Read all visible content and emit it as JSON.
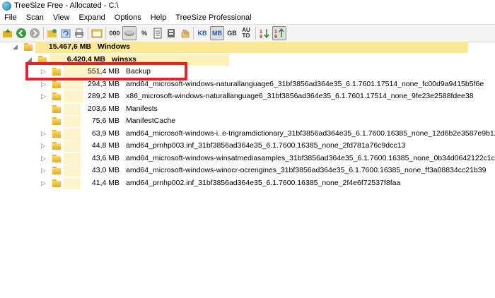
{
  "window": {
    "title": "TreeSize Free - Allocated - C:\\"
  },
  "menu": [
    "File",
    "Scan",
    "View",
    "Expand",
    "Options",
    "Help",
    "TreeSize Professional"
  ],
  "toolbar": {
    "text_buttons": {
      "digits": "000",
      "percent": "%",
      "kb": "KB",
      "mb": "MB",
      "gb": "GB",
      "auto": "AU TO"
    }
  },
  "tree": {
    "rows": [
      {
        "size": "15.467,6 MB",
        "name": "Windows",
        "arrow": "◢",
        "bar_fraction": 1.0
      },
      {
        "size": "6.420,4 MB",
        "name": "winsxs",
        "arrow": "◢",
        "bar_fraction": 0.415
      },
      {
        "size": "551,4 MB",
        "name": "Backup",
        "arrow": "▷",
        "bar_fraction": 0.086
      },
      {
        "size": "294,3 MB",
        "name": "amd64_microsoft-windows-naturallanguage6_31bf3856ad364e35_6.1.7601.17514_none_fc00d9a9415b5f6e",
        "arrow": "▷",
        "bar_fraction": 0.046
      },
      {
        "size": "289,2 MB",
        "name": "x86_microsoft-windows-naturallanguage6_31bf3856ad364e35_6.1.7601.17514_none_9fe23e2588fdee38",
        "arrow": "▷",
        "bar_fraction": 0.045
      },
      {
        "size": "203,6 MB",
        "name": "Manifests",
        "arrow": "",
        "bar_fraction": 0.032
      },
      {
        "size": "75,6 MB",
        "name": "ManifestCache",
        "arrow": "",
        "bar_fraction": 0.012
      },
      {
        "size": "63,9 MB",
        "name": "amd64_microsoft-windows-i..e-trigramdictionary_31bf3856ad364e35_6.1.7600.16385_none_12d6b2e3587e9b12",
        "arrow": "▷",
        "bar_fraction": 0.01
      },
      {
        "size": "44,8 MB",
        "name": "amd64_prnhp003.inf_31bf3856ad364e35_6.1.7600.16385_none_2fd781a76c9dcc13",
        "arrow": "▷",
        "bar_fraction": 0.007
      },
      {
        "size": "43,6 MB",
        "name": "amd64_microsoft-windows-winsatmediasamples_31bf3856ad364e35_6.1.7600.16385_none_0b34d0642122c1c4",
        "arrow": "▷",
        "bar_fraction": 0.007
      },
      {
        "size": "43,0 MB",
        "name": "amd64_microsoft-windows-winocr-ocrengines_31bf3856ad364e35_6.1.7600.16385_none_ff3a08834cc21b39",
        "arrow": "▷",
        "bar_fraction": 0.007
      },
      {
        "size": "41,4 MB",
        "name": "amd64_prnhp002.inf_31bf3856ad364e35_6.1.7600.16385_none_2f4e6f72537f8faa",
        "arrow": "▷",
        "bar_fraction": 0.006
      }
    ]
  },
  "colors": {
    "bar_root": "#fbe894",
    "bar_child": "#fdf1b8",
    "bar_leaf": "#fdf4cc",
    "highlight": "#e8202a"
  }
}
